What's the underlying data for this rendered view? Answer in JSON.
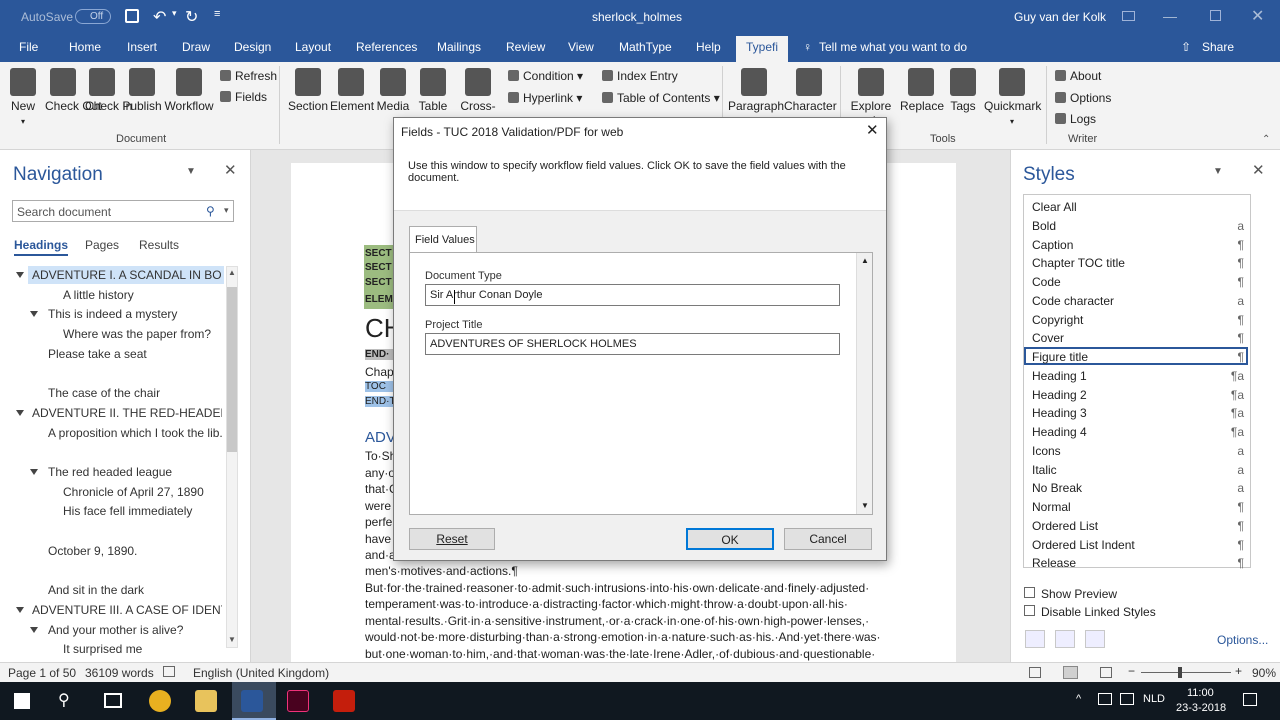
{
  "window": {
    "autosave_label": "AutoSave",
    "autosave_state": "Off",
    "doc_title": "sherlock_holmes",
    "user": "Guy van der Kolk"
  },
  "tabs": [
    "File",
    "Home",
    "Insert",
    "Draw",
    "Design",
    "Layout",
    "References",
    "Mailings",
    "Review",
    "View",
    "MathType",
    "Help",
    "Typefi"
  ],
  "tell_me": "Tell me what you want to do",
  "share": "Share",
  "ribbon": {
    "document_buttons": [
      "New",
      "Check Out",
      "Check In",
      "Publish",
      "Workflow"
    ],
    "refresh": "Refresh",
    "fields": "Fields",
    "document_group": "Document",
    "element_buttons": [
      "Section",
      "Element",
      "Media",
      "Table",
      "Cross-"
    ],
    "condition": "Condition",
    "hyperlink": "Hyperlink",
    "index_entry": "Index Entry",
    "toc": "Table of Contents",
    "para_buttons": [
      "Paragraph",
      "Character"
    ],
    "tools_buttons": [
      "Explore",
      "Replace",
      "Tags",
      "Quickmark"
    ],
    "explore_tail": "nt",
    "tools_group": "Tools",
    "about": "About",
    "options": "Options",
    "logs": "Logs",
    "writer_group": "Writer"
  },
  "nav": {
    "title": "Navigation",
    "search_placeholder": "Search document",
    "tabs": [
      "Headings",
      "Pages",
      "Results"
    ],
    "items": [
      {
        "label": "ADVENTURE I. A SCANDAL IN BOHE...",
        "level": 0,
        "tri": true,
        "selected": true
      },
      {
        "label": "A little history",
        "level": 2,
        "tri": false
      },
      {
        "label": "This is indeed a mystery",
        "level": 1,
        "tri": true
      },
      {
        "label": "Where was the paper from?",
        "level": 2,
        "tri": false
      },
      {
        "label": "Please take a seat",
        "level": 1,
        "tri": false
      },
      {
        "label": "",
        "level": 1,
        "tri": false
      },
      {
        "label": "The case of the chair",
        "level": 1,
        "tri": false
      },
      {
        "label": "ADVENTURE II. THE RED-HEADED LE...",
        "level": 0,
        "tri": true
      },
      {
        "label": "A proposition which I took the lib...",
        "level": 1,
        "tri": false
      },
      {
        "label": "",
        "level": 1,
        "tri": false
      },
      {
        "label": "The red headed league",
        "level": 1,
        "tri": true
      },
      {
        "label": "Chronicle of April 27, 1890",
        "level": 2,
        "tri": false
      },
      {
        "label": "His face fell immediately",
        "level": 2,
        "tri": false
      },
      {
        "label": "",
        "level": 1,
        "tri": false
      },
      {
        "label": "October 9, 1890.",
        "level": 1,
        "tri": false
      },
      {
        "label": "",
        "level": 1,
        "tri": false
      },
      {
        "label": "And sit in the dark",
        "level": 1,
        "tri": false
      },
      {
        "label": "ADVENTURE III. A CASE OF IDENTITY",
        "level": 0,
        "tri": true
      },
      {
        "label": "And your mother is alive?",
        "level": 1,
        "tri": true
      },
      {
        "label": "It surprised me",
        "level": 2,
        "tri": false
      }
    ]
  },
  "document": {
    "tags": [
      "SECT",
      "SECT",
      "SECT",
      "ELEM"
    ],
    "heading": "CH",
    "end": "END·",
    "chap": "Chap",
    "toc": "TOC",
    "end2": "END·T",
    "adv": "ADV",
    "left_lines": [
      "To·Sh",
      "any·o",
      "that·C",
      "were",
      "perfe",
      "have",
      "and·a"
    ],
    "lines": [
      "men's·motives·and·actions.¶",
      "But·for·the·trained·reasoner·to·admit·such·intrusions·into·his·own·delicate·and·finely·adjusted·",
      "temperament·was·to·introduce·a·distracting·factor·which·might·throw·a·doubt·upon·all·his·",
      "mental·results.·Grit·in·a·sensitive·instrument,·or·a·crack·in·one·of·his·own·high-power·lenses,·",
      "would·not·be·more·disturbing·than·a·strong·emotion·in·a·nature·such·as·his.·And·yet·there·was·",
      "but·one·woman·to·him,·and·that·woman·was·the·late·Irene·Adler,·of·dubious·and·questionable·"
    ]
  },
  "styles": {
    "title": "Styles",
    "items": [
      {
        "name": "Clear All",
        "glyph": ""
      },
      {
        "name": "Bold",
        "glyph": "a"
      },
      {
        "name": "Caption",
        "glyph": "¶"
      },
      {
        "name": "Chapter TOC title",
        "glyph": "¶"
      },
      {
        "name": "Code",
        "glyph": "¶"
      },
      {
        "name": "Code character",
        "glyph": "a"
      },
      {
        "name": "Copyright",
        "glyph": "¶"
      },
      {
        "name": "Cover",
        "glyph": "¶"
      },
      {
        "name": "Figure title",
        "glyph": "¶",
        "selected": true
      },
      {
        "name": "Heading 1",
        "glyph": "¶a"
      },
      {
        "name": "Heading 2",
        "glyph": "¶a"
      },
      {
        "name": "Heading 3",
        "glyph": "¶a"
      },
      {
        "name": "Heading 4",
        "glyph": "¶a"
      },
      {
        "name": "Icons",
        "glyph": "a"
      },
      {
        "name": "Italic",
        "glyph": "a"
      },
      {
        "name": "No Break",
        "glyph": "a"
      },
      {
        "name": "Normal",
        "glyph": "¶"
      },
      {
        "name": "Ordered List",
        "glyph": "¶"
      },
      {
        "name": "Ordered List Indent",
        "glyph": "¶"
      },
      {
        "name": "Release",
        "glyph": "¶"
      }
    ],
    "show_preview": "Show Preview",
    "disable_linked": "Disable Linked Styles",
    "options": "Options..."
  },
  "status": {
    "page": "Page 1 of 50",
    "words": "36109 words",
    "language": "English (United Kingdom)",
    "zoom": "90%"
  },
  "taskbar": {
    "lang": "NLD",
    "time": "11:00",
    "date": "23-3-2018"
  },
  "dialog": {
    "title": "Fields - TUC 2018 Validation/PDF for web",
    "description": "Use this window to specify workflow field values. Click OK to save the field values with the document.",
    "tab": "Field Values",
    "field1_label": "Document Type",
    "field1_value": "Sir Arthur Conan Doyle",
    "field2_label": "Project Title",
    "field2_value": "ADVENTURES OF SHERLOCK HOLMES",
    "reset": "Reset",
    "ok": "OK",
    "cancel": "Cancel"
  },
  "colors": {
    "word_blue": "#2b579a",
    "selection": "#cfe3f8",
    "taskbar": "#101820"
  }
}
